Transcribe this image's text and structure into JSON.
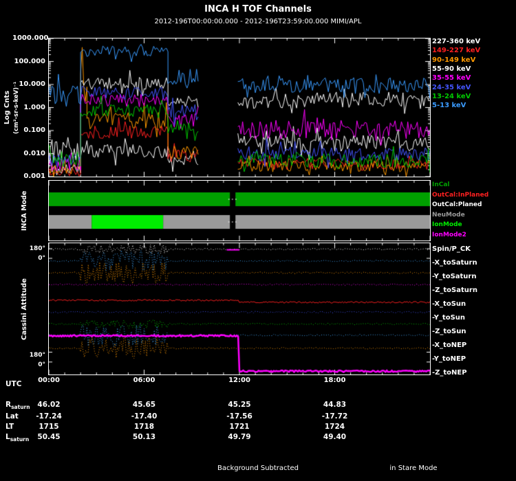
{
  "title": "INCA H TOF Channels",
  "subtitle": "2012-196T00:00:00.000 - 2012-196T23:59:00.000 MIMI/APL",
  "footer": {
    "center": "Background Subtracted",
    "right": "in Stare Mode"
  },
  "xaxis": {
    "label": "UTC",
    "tick_labels": [
      "00:00",
      "06:00",
      "12:00",
      "18:00"
    ],
    "tick_hours": [
      0,
      6,
      12,
      18
    ]
  },
  "top_panel": {
    "ylabel": "Log Cnts",
    "yunits": "(cm²-sr-s-keV)⁻¹",
    "ytick_labels": [
      "1000.000",
      "100.000",
      "10.000",
      "1.000",
      "0.100",
      "0.010",
      "0.001"
    ],
    "legend": [
      {
        "label": "227-360 keV",
        "color": "#ffffff"
      },
      {
        "label": "149-227 keV",
        "color": "#ff2020"
      },
      {
        "label": "90-149 keV",
        "color": "#ff9900"
      },
      {
        "label": "55-90 keV",
        "color": "#ffffff"
      },
      {
        "label": "35-55 keV",
        "color": "#ff00ff"
      },
      {
        "label": "24-35 keV",
        "color": "#4455ff"
      },
      {
        "label": "13-24 keV",
        "color": "#00c800"
      },
      {
        "label": "5-13 keV",
        "color": "#3a9bff"
      }
    ]
  },
  "mode_panel": {
    "ylabel": "INCA Mode",
    "legend": [
      {
        "label": "InCal",
        "color": "#00a000"
      },
      {
        "label": "OutCal:InPlaned",
        "color": "#ff2020"
      },
      {
        "label": "OutCal:Planed",
        "color": "#ffffff"
      },
      {
        "label": "NeuMode",
        "color": "#9a9a9a"
      },
      {
        "label": "IonMode",
        "color": "#00ee00"
      },
      {
        "label": "IonMode2",
        "color": "#ff00ff"
      }
    ]
  },
  "attitude_panel": {
    "ylabel": "Cassini Attitude",
    "ytick_labels": [
      "180°",
      "0°",
      "180°",
      "0°"
    ]
  },
  "ephemeris": {
    "rows": [
      {
        "label": "R",
        "sub": "saturn",
        "values": [
          "46.02",
          "45.65",
          "45.25",
          "44.83"
        ]
      },
      {
        "label": "Lat",
        "sub": "",
        "values": [
          "-17.24",
          "-17.40",
          "-17.56",
          "-17.72"
        ]
      },
      {
        "label": "LT",
        "sub": "",
        "values": [
          "1715",
          "1718",
          "1721",
          "1724"
        ]
      },
      {
        "label": "L",
        "sub": "saturn",
        "values": [
          "50.45",
          "50.13",
          "49.79",
          "49.40"
        ]
      }
    ]
  },
  "chart_data": {
    "type": "line",
    "title": "INCA H TOF Channels",
    "time_axis": {
      "start": "2012-196T00:00:00.000",
      "end": "2012-196T23:59:00.000",
      "hours_range": [
        0,
        24
      ],
      "tick_hours": [
        0,
        6,
        12,
        18
      ],
      "tick_labels": [
        "00:00",
        "06:00",
        "12:00",
        "18:00"
      ]
    },
    "panels": [
      {
        "id": "tof_counts",
        "type": "line",
        "ylabel": "Log Cnts (cm2-sr-s-keV)-1",
        "yscale": "log",
        "ylim": [
          0.001,
          1000
        ],
        "data_gap_hours": [
          9.4,
          11.9
        ],
        "series": [
          {
            "name": "227-360 keV",
            "color": "#ffffff",
            "segments_hr_log10_amp": [
              [
                0,
                2,
                -2.7,
                0.25
              ],
              [
                2,
                7.5,
                -1.9,
                0.3
              ],
              [
                7.5,
                9.4,
                -2.3,
                0.25
              ],
              [
                11.9,
                24,
                -1.55,
                0.35
              ]
            ]
          },
          {
            "name": "149-227 keV",
            "color": "#ff2020",
            "segments_hr_log10_amp": [
              [
                0,
                2,
                -2.8,
                0.2
              ],
              [
                2,
                7.5,
                -1.05,
                0.3
              ],
              [
                7.5,
                9.4,
                -2.1,
                0.3
              ],
              [
                11.9,
                24,
                -2.45,
                0.25
              ]
            ]
          },
          {
            "name": "90-149 keV",
            "color": "#ff9900",
            "segments_hr_log10_amp": [
              [
                0,
                2,
                -2.6,
                0.3
              ],
              [
                2,
                2.4,
                0.9,
                0.8
              ],
              [
                2.4,
                7.5,
                -0.55,
                0.35
              ],
              [
                7.5,
                9.4,
                -1.95,
                0.3
              ],
              [
                11.9,
                24,
                -2.55,
                0.25
              ]
            ]
          },
          {
            "name": "55-90 keV",
            "color": "#ffffff",
            "segments_hr_log10_amp": [
              [
                0,
                2,
                -1.8,
                0.6
              ],
              [
                2,
                7.5,
                1.05,
                0.28
              ],
              [
                7.5,
                9.4,
                0.2,
                0.3
              ],
              [
                11.9,
                24,
                0.3,
                0.38
              ]
            ]
          },
          {
            "name": "35-55 keV",
            "color": "#ff00ff",
            "segments_hr_log10_amp": [
              [
                0,
                2,
                -2.4,
                0.35
              ],
              [
                2,
                7.5,
                0.3,
                0.3
              ],
              [
                7.5,
                9.4,
                -0.55,
                0.3
              ],
              [
                11.9,
                24,
                -1.0,
                0.45
              ]
            ]
          },
          {
            "name": "24-35 keV",
            "color": "#4455ff",
            "segments_hr_log10_amp": [
              [
                0,
                2,
                -2.35,
                0.3
              ],
              [
                2,
                7.5,
                0.65,
                0.28
              ],
              [
                7.5,
                9.4,
                -0.15,
                0.3
              ],
              [
                11.9,
                24,
                -2.0,
                0.3
              ]
            ]
          },
          {
            "name": "13-24 keV",
            "color": "#00c800",
            "segments_hr_log10_amp": [
              [
                0,
                2,
                -2.25,
                0.35
              ],
              [
                2,
                7.5,
                -0.1,
                0.3
              ],
              [
                7.5,
                9.4,
                -0.85,
                0.3
              ],
              [
                11.9,
                24,
                -2.3,
                0.3
              ]
            ]
          },
          {
            "name": "5-13 keV",
            "color": "#3a9bff",
            "segments_hr_log10_amp": [
              [
                0,
                2,
                0.45,
                0.5
              ],
              [
                2,
                7.5,
                2.45,
                0.22
              ],
              [
                7.5,
                9.4,
                1.35,
                0.35
              ],
              [
                11.9,
                24,
                0.95,
                0.35
              ]
            ]
          }
        ]
      },
      {
        "id": "inca_mode",
        "type": "bands",
        "bars": [
          {
            "row": 0,
            "segments": [
              {
                "t0": 0,
                "t1": 11.4,
                "color": "#00a000"
              },
              {
                "t0": 11.75,
                "t1": 24,
                "color": "#00a000"
              }
            ]
          },
          {
            "row": 1,
            "segments": [
              {
                "t0": 0,
                "t1": 2.7,
                "color": "#9a9a9a"
              },
              {
                "t0": 2.7,
                "t1": 7.2,
                "color": "#00ee00"
              },
              {
                "t0": 7.2,
                "t1": 11.4,
                "color": "#9a9a9a"
              },
              {
                "t0": 11.75,
                "t1": 24,
                "color": "#9a9a9a"
              }
            ]
          }
        ],
        "gap_hours": [
          11.4,
          11.75
        ]
      },
      {
        "id": "cassini_attitude",
        "type": "line",
        "ylim_deg": [
          0,
          180
        ],
        "wiggle_interval_hours": [
          2,
          7.5
        ],
        "traces": [
          {
            "name": "Spin/P_CK",
            "color": "#ffffff",
            "base": 0.045,
            "wiggle": 7,
            "dash": true,
            "lw": 1,
            "step": null
          },
          {
            "name": "-X_toSaturn",
            "color": "#44aaff",
            "base": 0.135,
            "wiggle": 16,
            "dash": true,
            "lw": 1,
            "step": null
          },
          {
            "name": "-Y_toSaturn",
            "color": "#ff9900",
            "base": 0.225,
            "wiggle": 16,
            "dash": true,
            "lw": 1,
            "step": null
          },
          {
            "name": "-Z_toSaturn",
            "color": "#ff00ff",
            "base": 0.315,
            "wiggle": 0,
            "dash": true,
            "lw": 1,
            "step": null
          },
          {
            "name": "-X_toSun",
            "color": "#ff2020",
            "base": 0.435,
            "wiggle": 0,
            "dash": false,
            "lw": 1,
            "step": [
              12.0,
              0.45
            ]
          },
          {
            "name": "-Y_toSun",
            "color": "#4455ff",
            "base": 0.525,
            "wiggle": 0,
            "dash": true,
            "lw": 1,
            "step": null
          },
          {
            "name": "-Z_toSun",
            "color": "#00c800",
            "base": 0.615,
            "wiggle": 6,
            "dash": true,
            "lw": 1,
            "step": null
          },
          {
            "name": "-X_toNEP",
            "color": "#44aaff",
            "base": 0.7,
            "wiggle": 16,
            "dash": true,
            "lw": 1,
            "step": null
          },
          {
            "name": "-Y_toNEP",
            "color": "#ff9900",
            "base": 0.8,
            "wiggle": 16,
            "dash": true,
            "lw": 1,
            "step": null
          },
          {
            "name": "-Z_toNEP",
            "color": "#ff00ff",
            "base": 0.705,
            "wiggle": 0,
            "dash": false,
            "lw": 2.5,
            "step": [
              12.0,
              0.975
            ]
          }
        ],
        "extras": [
          {
            "t0": 11.2,
            "t1": 12.0,
            "frac": 0.05,
            "color": "#ff00ff",
            "lw": 2
          }
        ]
      }
    ],
    "ephemeris_table": {
      "tick_labels": [
        "00:00",
        "06:00",
        "12:00",
        "18:00"
      ],
      "R_saturn": [
        46.02,
        45.65,
        45.25,
        44.83
      ],
      "Lat": [
        -17.24,
        -17.4,
        -17.56,
        -17.72
      ],
      "LT": [
        1715,
        1718,
        1721,
        1724
      ],
      "L_saturn": [
        50.45,
        50.13,
        49.79,
        49.4
      ]
    }
  }
}
